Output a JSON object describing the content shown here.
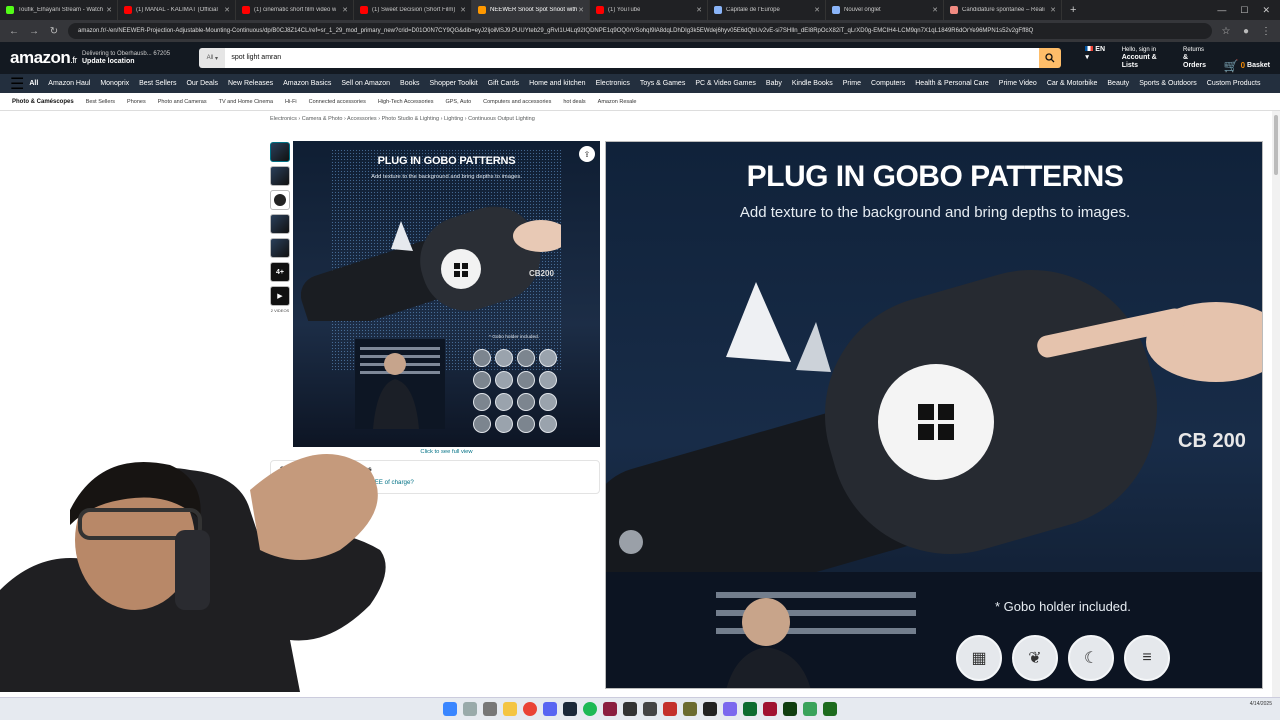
{
  "browser": {
    "tabs": [
      {
        "label": "Toufik_Elhayani Stream - Watch",
        "color": "#53fc18"
      },
      {
        "label": "(1) MANAL - KALIMAT (Official",
        "color": "#ff0000"
      },
      {
        "label": "(1) cinematic short film video w",
        "color": "#ff0000"
      },
      {
        "label": "(1) Sweet Decision (Short Film)",
        "color": "#ff0000"
      },
      {
        "label": "NEEWER Snoot Spot Snoot with",
        "color": "#ff9900",
        "active": true
      },
      {
        "label": "(1) YouTube",
        "color": "#ff0000"
      },
      {
        "label": "Capitale de l'Europe",
        "color": "#8ab4f8"
      },
      {
        "label": "Nouvel onglet",
        "color": "#8ab4f8"
      },
      {
        "label": "Candidature spontanée – Réali",
        "color": "#f28b82"
      }
    ],
    "url": "amazon.fr/-/en/NEEWER-Projection-Adjustable-Mounting-Continuous/dp/B0CJ8Z14CL/ref=sr_1_29_mod_primary_new?crid=D01O0N7CY9QG&dib=eyJ2IjoiMSJ9.PUUYteb29_gRvI1U4Lq92IQDNPE1q9OQ0rVSohqI9lA8dqLDhDIg3k5EWdej6hyv05E6dQbUv2vE-si7SHIln_dEI8RpOcX82iT_qLrXD0g-EMCIH4-LCM9qn7X1qL1849R6dOrYe96MPN1s52v2gFff8Q"
  },
  "amazon": {
    "logo": "amazon",
    "logo_tld": ".fr",
    "deliver_line1": "Delivering to Oberhausb... 67205",
    "deliver_line2": "Update location",
    "search_category": "All",
    "search_value": "spot light amran",
    "lang": "EN",
    "account_line1": "Hello, sign in",
    "account_line2": "Account & Lists",
    "returns_line1": "Returns",
    "returns_line2": "& Orders",
    "basket_label": "Basket",
    "basket_count": "0"
  },
  "navbelt": [
    "All",
    "Amazon Haul",
    "Monoprix",
    "Best Sellers",
    "Our Deals",
    "New Releases",
    "Amazon Basics",
    "Sell on Amazon",
    "Books",
    "Shopper Toolkit",
    "Gift Cards",
    "Home and kitchen",
    "Electronics",
    "Toys & Games",
    "PC & Video Games",
    "Baby",
    "Kindle Books",
    "Prime",
    "Computers",
    "Health & Personal Care",
    "Prime Video",
    "Car & Motorbike",
    "Beauty",
    "Sports & Outdoors",
    "Custom Products"
  ],
  "subnav": [
    "Photo & Caméscopes",
    "Best Sellers",
    "Phones",
    "Photo and Cameras",
    "TV and Home Cinema",
    "Hi-Fi",
    "Connected accessories",
    "High-Tech Accessories",
    "GPS, Auto",
    "Computers and accessories",
    "hot deals",
    "Amazon Resale"
  ],
  "breadcrumb": "Electronics › Camera & Photo › Accessories › Photo Studio & Lighting › Lighting › Continuous Output Lighting",
  "thumbs": {
    "more_label": "4+",
    "videos_label": "2 VIDEOS"
  },
  "main_image": {
    "title": "PLUG IN GOBO PATTERNS",
    "subtitle": "Add texture to the background and bring depths to images.",
    "note": "* Gobo holder included.",
    "click_label": "Click to see full view",
    "lamp_label": "CB200"
  },
  "safety": {
    "title": "Safety and product resources",
    "link": "Want to recycle your product FREE of charge?"
  },
  "zoom": {
    "title": "PLUG IN GOBO PATTERNS",
    "subtitle": "Add texture to the background and bring depths to images.",
    "note": "* Gobo holder included.",
    "lamp_label": "CB 200"
  },
  "taskbar": {
    "date": "4/14/2025"
  }
}
